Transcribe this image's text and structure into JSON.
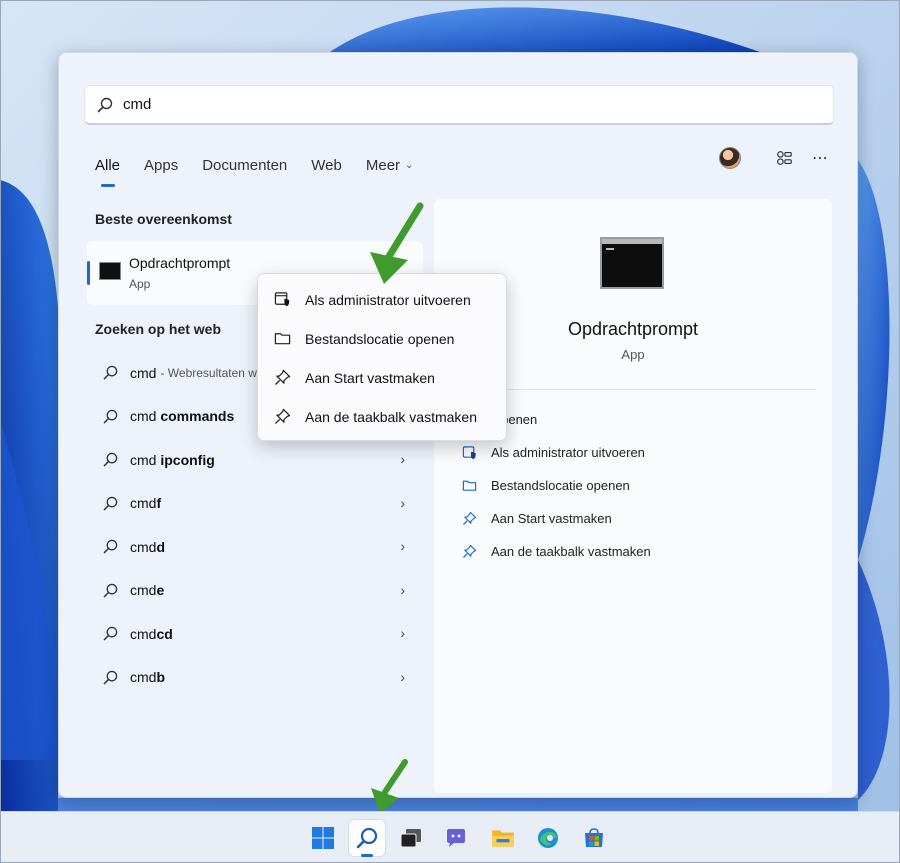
{
  "search": {
    "value": "cmd"
  },
  "tabs": [
    {
      "label": "Alle",
      "active": true
    },
    {
      "label": "Apps"
    },
    {
      "label": "Documenten"
    },
    {
      "label": "Web"
    },
    {
      "label": "Meer"
    }
  ],
  "best_match": {
    "section_title": "Beste overeenkomst",
    "title": "Opdrachtprompt",
    "subtitle": "App"
  },
  "web_search": {
    "section_title": "Zoeken op het web",
    "items": [
      {
        "prefix": "cmd",
        "bold": "",
        "hint": "- Webresultaten weergeven"
      },
      {
        "prefix": "cmd ",
        "bold": "commands",
        "hint": ""
      },
      {
        "prefix": "cmd ",
        "bold": "ipconfig",
        "hint": ""
      },
      {
        "prefix": "cmd",
        "bold": "f",
        "hint": ""
      },
      {
        "prefix": "cmd",
        "bold": "d",
        "hint": ""
      },
      {
        "prefix": "cmd",
        "bold": "e",
        "hint": ""
      },
      {
        "prefix": "cmd",
        "bold": "cd",
        "hint": ""
      },
      {
        "prefix": "cmd",
        "bold": "b",
        "hint": ""
      }
    ]
  },
  "context_menu": {
    "items": [
      {
        "label": "Als administrator uitvoeren",
        "icon": "admin-shield-icon"
      },
      {
        "label": "Bestandslocatie openen",
        "icon": "folder-icon"
      },
      {
        "label": "Aan Start vastmaken",
        "icon": "pin-icon"
      },
      {
        "label": "Aan de taakbalk vastmaken",
        "icon": "pin-icon"
      }
    ]
  },
  "detail": {
    "title": "Opdrachtprompt",
    "subtitle": "App",
    "actions": [
      {
        "label": "Openen",
        "icon": "open-icon"
      },
      {
        "label": "Als administrator uitvoeren",
        "icon": "admin-shield-icon"
      },
      {
        "label": "Bestandslocatie openen",
        "icon": "folder-icon"
      },
      {
        "label": "Aan Start vastmaken",
        "icon": "pin-icon"
      },
      {
        "label": "Aan de taakbalk vastmaken",
        "icon": "pin-icon"
      }
    ]
  },
  "taskbar": {
    "icons": [
      "windows-start-icon",
      "search-icon",
      "task-view-icon",
      "teams-chat-icon",
      "file-explorer-icon",
      "edge-browser-icon",
      "microsoft-store-icon"
    ]
  },
  "colors": {
    "accent": "#1a6bd1",
    "arrow": "#3e9b2c"
  }
}
